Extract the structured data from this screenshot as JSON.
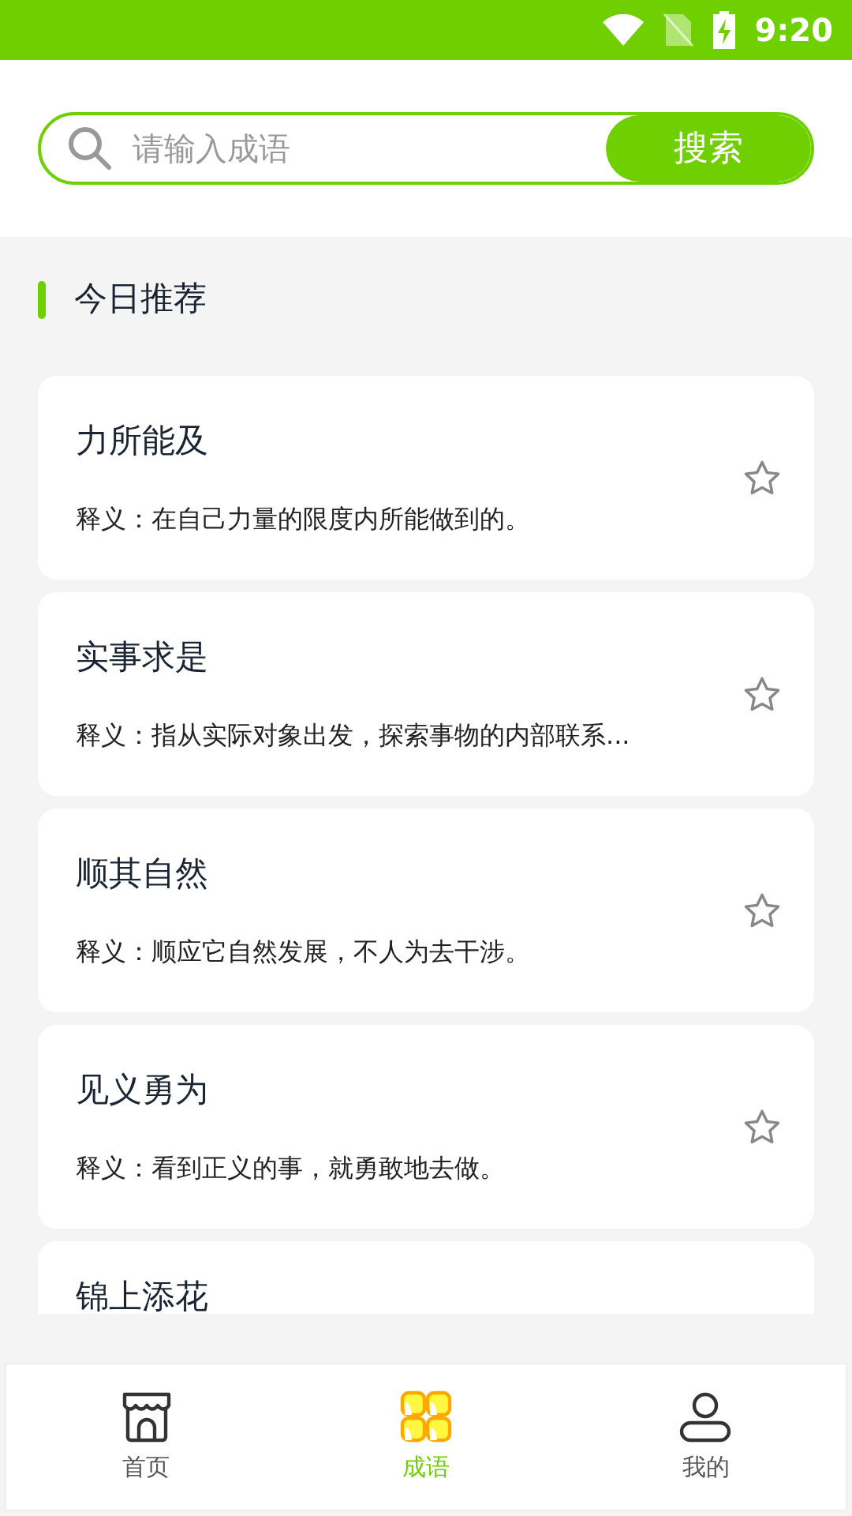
{
  "status_bar": {
    "time": "9:20"
  },
  "search": {
    "placeholder": "请输入成语",
    "button": "搜索"
  },
  "section": {
    "title": "今日推荐"
  },
  "idioms": [
    {
      "title": "力所能及",
      "meaning": "释义：在自己力量的限度内所能做到的。",
      "starred": false
    },
    {
      "title": "实事求是",
      "meaning": "释义：指从实际对象出发，探索事物的内部联系...",
      "starred": false
    },
    {
      "title": "顺其自然",
      "meaning": "释义：顺应它自然发展，不人为去干涉。",
      "starred": false
    },
    {
      "title": "见义勇为",
      "meaning": "释义：看到正义的事，就勇敢地去做。",
      "starred": false
    },
    {
      "title": "锦上添花"
    }
  ],
  "nav": [
    {
      "label": "首页",
      "kind": "home",
      "selected": false
    },
    {
      "label": "成语",
      "kind": "idioms",
      "selected": true
    },
    {
      "label": "我的",
      "kind": "profile",
      "selected": false
    }
  ]
}
